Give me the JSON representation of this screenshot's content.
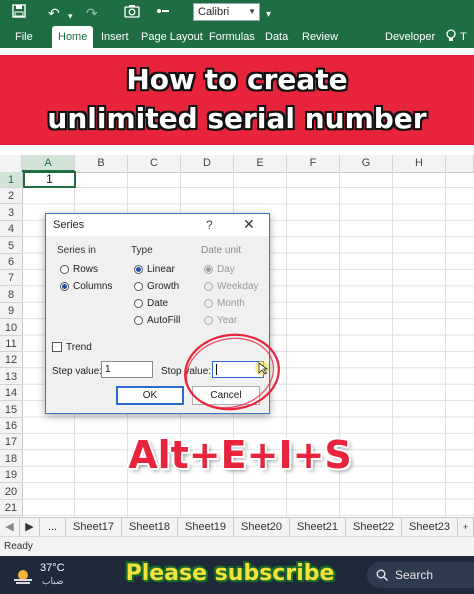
{
  "quick_access": {
    "font_name": "Calibri"
  },
  "ribbon": {
    "tabs": [
      "File",
      "Home",
      "Insert",
      "Page Layout",
      "Formulas",
      "Data",
      "Review",
      "Developer"
    ],
    "active_tab": "Home"
  },
  "banner": {
    "line1": "How to create",
    "line2": "unlimited serial number"
  },
  "grid": {
    "columns": [
      "A",
      "B",
      "C",
      "D",
      "E",
      "F",
      "G",
      "H"
    ],
    "rows": [
      "1",
      "2",
      "3",
      "4",
      "5",
      "6",
      "7",
      "8",
      "9",
      "10",
      "11",
      "12",
      "13",
      "14",
      "15",
      "16",
      "17",
      "18",
      "19",
      "20",
      "21"
    ],
    "cell_a1": "1"
  },
  "dialog": {
    "title": "Series",
    "help": "?",
    "close": "✕",
    "series_in_label": "Series in",
    "series_in_options": [
      "Rows",
      "Columns"
    ],
    "series_in_selected": "Columns",
    "type_label": "Type",
    "type_options": [
      "Linear",
      "Growth",
      "Date",
      "AutoFill"
    ],
    "type_selected": "Linear",
    "date_unit_label": "Date unit",
    "date_unit_options": [
      "Day",
      "Weekday",
      "Month",
      "Year"
    ],
    "date_unit_selected": "Day",
    "trend_label": "Trend",
    "step_label": "Step value:",
    "step_value": "1",
    "stop_label": "Stop value:",
    "stop_value": "",
    "ok_label": "OK",
    "cancel_label": "Cancel",
    "highlight_color": "#e8233c"
  },
  "overlay": {
    "keys": "Alt+E+I+S"
  },
  "sheets": {
    "nav": "...",
    "tabs": [
      "Sheet17",
      "Sheet18",
      "Sheet19",
      "Sheet20",
      "Sheet21",
      "Sheet22",
      "Sheet23"
    ]
  },
  "status": {
    "text": "Ready"
  },
  "taskbar": {
    "temperature": "37°C",
    "weather_text": "ضباب",
    "subscribe": "Please subscribe",
    "search_label": "Search"
  },
  "colors": {
    "excel_green": "#1e6e42",
    "banner_red": "#e8233c",
    "subscribe_yellow": "#f4e23a"
  },
  "icons": [
    "save-icon",
    "undo-icon",
    "redo-icon",
    "camera-icon",
    "bullet-icon",
    "lightbulb-icon",
    "sheet-prev-icon",
    "sheet-next-icon",
    "weather-icon",
    "search-icon"
  ]
}
